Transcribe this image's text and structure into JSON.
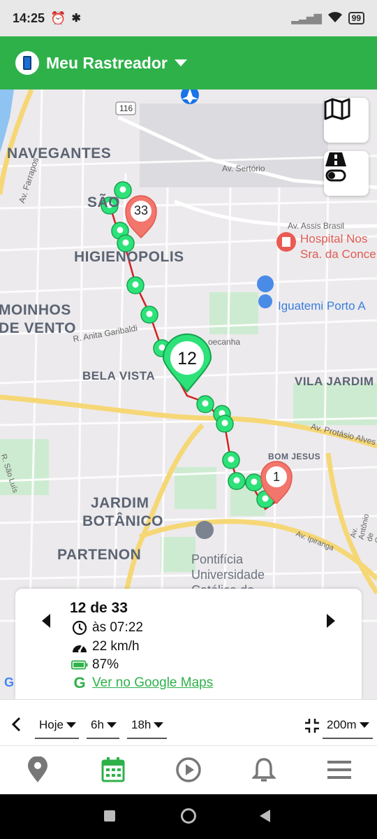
{
  "status_bar": {
    "time": "14:25",
    "battery": "99"
  },
  "appbar": {
    "title": "Meu Rastreador"
  },
  "map": {
    "labels": {
      "navegantes": "NAVEGANTES",
      "sao_joao": "SÃO",
      "higienopolis": "HIGIENOPOLIS",
      "moinhos1": "MOINHOS",
      "moinhos2": "DE VENTO",
      "bela_vista": "BELA VISTA",
      "vila_jardim": "VILA JARDIM",
      "bom_jesus": "BOM JESUS",
      "jardim1": "JARDIM",
      "jardim2": "BOTÂNICO",
      "partenon": "PARTENON",
      "av_sertorio": "Av. Sertório",
      "av_farrapos": "Av. Farrapos",
      "av_assis": "Av. Assis Brasil",
      "r_anita": "R. Anita Garibaldi",
      "protasio": "Av. Protásio Alves",
      "r_sao_luis": "R. São Luís",
      "antonio": "Av. Antônio de Carvalho",
      "ipiranga": "Av. Ipiranga",
      "cecanha": "oecanha",
      "route116": "116"
    },
    "pois": {
      "hospital1": "Hospital Nos",
      "hospital2": "Sra. da Conce",
      "iguatemi": "Iguatemi Porto A",
      "puc1": "Pontifícia",
      "puc2": "Universidade",
      "puc3": "Católica do"
    },
    "markers": {
      "cluster_start": "33",
      "current": "12",
      "cluster_end": "1"
    },
    "google": "G"
  },
  "info": {
    "count": "12 de 33",
    "time": "às 07:22",
    "speed": "22 km/h",
    "battery": "87%",
    "maps_link": "Ver no Google Maps"
  },
  "filters": {
    "day": "Hoje",
    "from": "6h",
    "to": "18h",
    "radius": "200m"
  },
  "colors": {
    "primary": "#2fb14a",
    "marker_green": "#2ee27a",
    "marker_red": "#f2766c",
    "route": "#d42020"
  }
}
